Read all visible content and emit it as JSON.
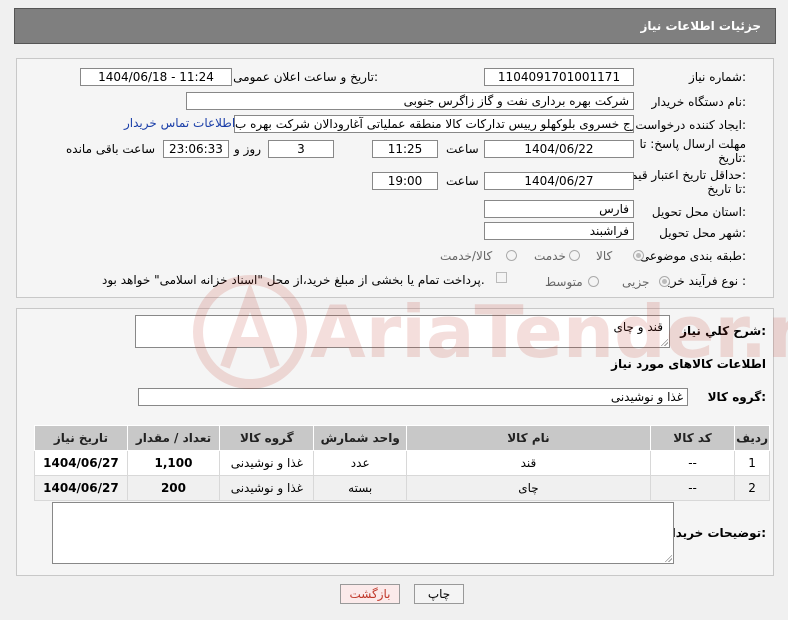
{
  "header": {
    "title": "جزئیات اطلاعات نیاز"
  },
  "labels": {
    "need_number": "شماره نیاز:",
    "announce_datetime": "تاریخ و ساعت اعلان عمومی:",
    "buyer_org": "نام دستگاه خریدار:",
    "requester": "ایجاد کننده درخواست:",
    "reply_deadline_1": "مهلت ارسال پاسخ: تا",
    "reply_deadline_2": "تاریخ:",
    "price_validity_1": "حداقل تاریخ اعتبار قیمت:",
    "price_validity_2": "تا تاریخ:",
    "hour": "ساعت",
    "day_and": "روز و",
    "hours_left": "ساعت باقی مانده",
    "province": "استان محل تحویل:",
    "city": "شهر محل تحویل:",
    "category": "طبقه بندی موضوعی:",
    "purchase_type": "نوع فرآیند خرید :",
    "description": "شرح کلي نياز:",
    "items_info": "اطلاعات کالاهای مورد نیاز",
    "goods_group": "گروه کالا:",
    "buyer_notes": "توضیحات خریدار:"
  },
  "values": {
    "need_number": "1104091701001171",
    "announce_datetime": "1404/06/18 - 11:24",
    "buyer_org": "شرکت بهره برداری نفت و گاز زاگرس جنوبی",
    "requester": "تورج خسروی بلوکهلو رییس تدارکات کالا منطقه عملیاتی آغارودالان شرکت بهره ب",
    "contact_link": "اطلاعات تماس خریدار",
    "reply_date": "1404/06/22",
    "reply_time": "11:25",
    "days": "3",
    "remaining": "23:06:33",
    "price_date": "1404/06/27",
    "price_time": "19:00",
    "province": "فارس",
    "city": "فراشبند",
    "description": "قند و چای",
    "goods_group": "غذا و نوشیدنی",
    "buyer_notes": ""
  },
  "category_options": {
    "goods": "کالا",
    "service": "خدمت",
    "goods_service": "کالا/خدمت",
    "selected": "goods"
  },
  "purchase_options": {
    "partial": "جزیی",
    "medium": "متوسط",
    "selected": "partial"
  },
  "payment_note": "پرداخت تمام یا بخشی از مبلغ خرید،از محل \"اسناد خزانه اسلامی\" خواهد بود.",
  "table": {
    "headers": [
      "ردیف",
      "کد کالا",
      "نام کالا",
      "واحد شمارش",
      "گروه کالا",
      "تعداد / مقدار",
      "تاریخ نیاز"
    ],
    "rows": [
      [
        "1",
        "--",
        "قند",
        "عدد",
        "غذا و نوشیدنی",
        "1,100",
        "1404/06/27"
      ],
      [
        "2",
        "--",
        "چای",
        "بسته",
        "غذا و نوشیدنی",
        "200",
        "1404/06/27"
      ]
    ]
  },
  "buttons": {
    "print": "چاپ",
    "back": "بازگشت"
  },
  "watermark": "AriaTender.net",
  "colors": {
    "header_bg": "#7f7f7f",
    "link": "#1a3ea8",
    "back_text": "#c0392b"
  }
}
